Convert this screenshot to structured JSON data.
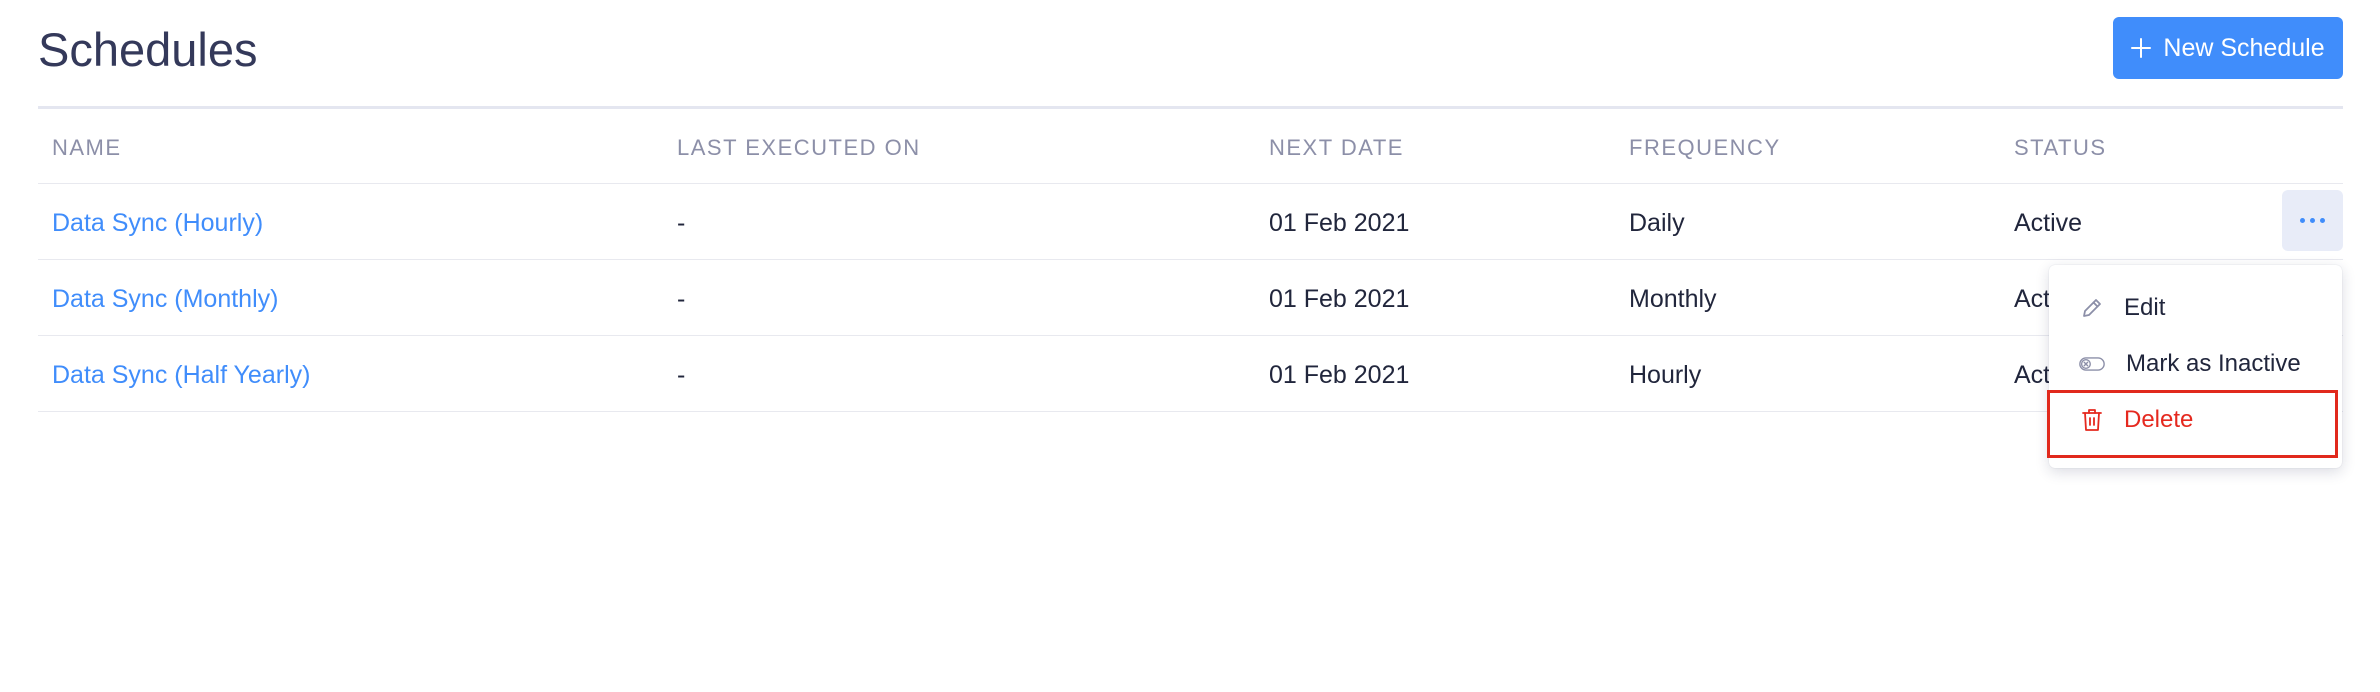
{
  "page": {
    "title": "Schedules",
    "new_button_label": "New Schedule"
  },
  "table": {
    "columns": [
      "NAME",
      "LAST EXECUTED ON",
      "NEXT DATE",
      "FREQUENCY",
      "STATUS"
    ],
    "rows": [
      {
        "name": "Data Sync (Hourly)",
        "last_executed": "-",
        "next_date": "01 Feb 2021",
        "frequency": "Daily",
        "status": "Active"
      },
      {
        "name": "Data Sync (Monthly)",
        "last_executed": "-",
        "next_date": "01 Feb 2021",
        "frequency": "Monthly",
        "status": "Act"
      },
      {
        "name": "Data Sync (Half Yearly)",
        "last_executed": "-",
        "next_date": "01 Feb 2021",
        "frequency": "Hourly",
        "status": "Act"
      }
    ]
  },
  "row_menu": {
    "items": [
      {
        "label": "Edit",
        "icon": "pencil-icon"
      },
      {
        "label": "Mark as Inactive",
        "icon": "toggle-off-icon"
      },
      {
        "label": "Delete",
        "icon": "trash-icon"
      }
    ],
    "highlighted_item": "Delete"
  },
  "colors": {
    "accent": "#408dfb",
    "danger": "#e5291f",
    "highlight_border": "#e1291c",
    "text": "#21263c",
    "header_text": "#8c8fa8"
  },
  "icons": {
    "new_button": "plus-icon",
    "row_actions": "more-horizontal-icon"
  }
}
